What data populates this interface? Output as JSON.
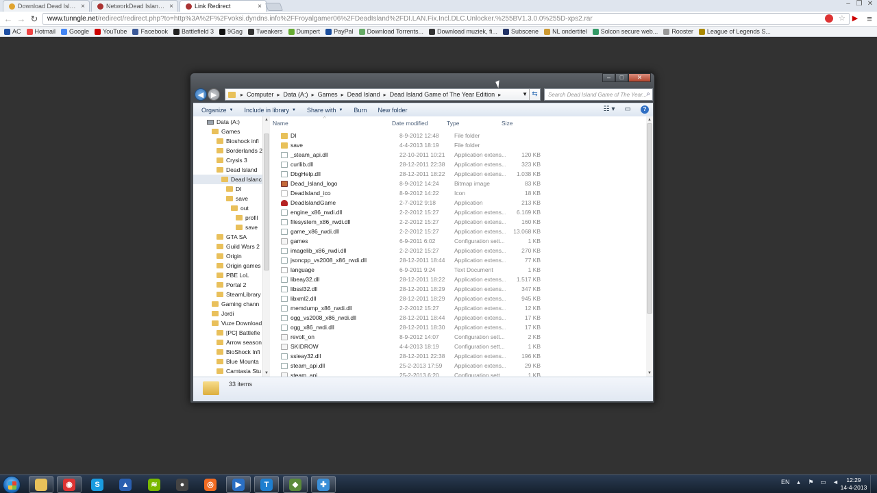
{
  "browser": {
    "tabs": [
      {
        "label": "Download Dead Island Ga",
        "active": false,
        "color": "#e0a32e"
      },
      {
        "label": "NetworkDead Island - Tu",
        "active": false,
        "color": "#a33"
      },
      {
        "label": "Link Redirect",
        "active": true,
        "color": "#a33"
      }
    ],
    "url_domain": "www.tunngle.net",
    "url_rest": "/redirect/redirect.php?to=http%3A%2F%2Fvoksi.dyndns.info%2FFroyalgamer06%2FDeadIsland%2FDI.LAN.Fix.Incl.DLC.Unlocker.%255BV1.3.0.0%255D-xps2.rar",
    "bookmarks": [
      {
        "label": "AC",
        "color": "#1e4fa3"
      },
      {
        "label": "Hotmail",
        "color": "#e44"
      },
      {
        "label": "Google",
        "color": "#4285f4"
      },
      {
        "label": "YouTube",
        "color": "#c00"
      },
      {
        "label": "Facebook",
        "color": "#3b5998"
      },
      {
        "label": "Battlefield 3",
        "color": "#222"
      },
      {
        "label": "9Gag",
        "color": "#111"
      },
      {
        "label": "Tweakers",
        "color": "#333"
      },
      {
        "label": "Dumpert",
        "color": "#6a3"
      },
      {
        "label": "PayPal",
        "color": "#1a4d9c"
      },
      {
        "label": "Download Torrents...",
        "color": "#6a6"
      },
      {
        "label": "Download muziek, fi...",
        "color": "#333"
      },
      {
        "label": "Subscene",
        "color": "#236"
      },
      {
        "label": "NL ondertitel",
        "color": "#c93"
      },
      {
        "label": "Solcon secure web...",
        "color": "#396"
      },
      {
        "label": "Rooster",
        "color": "#999"
      },
      {
        "label": "League of Legends S...",
        "color": "#a80"
      }
    ]
  },
  "explorer": {
    "breadcrumb": [
      "Computer",
      "Data (A:)",
      "Games",
      "Dead Island",
      "Dead Island Game of The Year Edition"
    ],
    "search_placeholder": "Search Dead Island Game of The Year...",
    "toolbar": {
      "organize": "Organize",
      "include": "Include in library",
      "share": "Share with",
      "burn": "Burn",
      "new_folder": "New folder"
    },
    "tree": [
      {
        "label": "Data (A:)",
        "indent": 0,
        "kind": "drive"
      },
      {
        "label": "Games",
        "indent": 1,
        "kind": "folder"
      },
      {
        "label": "Bioshock infi",
        "indent": 2,
        "kind": "folder"
      },
      {
        "label": "Borderlands 2",
        "indent": 2,
        "kind": "folder"
      },
      {
        "label": "Crysis 3",
        "indent": 2,
        "kind": "folder"
      },
      {
        "label": "Dead Island",
        "indent": 2,
        "kind": "folder"
      },
      {
        "label": "Dead Islanc",
        "indent": 3,
        "kind": "folder",
        "selected": true
      },
      {
        "label": "DI",
        "indent": 4,
        "kind": "folder"
      },
      {
        "label": "save",
        "indent": 4,
        "kind": "folder"
      },
      {
        "label": "out",
        "indent": 5,
        "kind": "folder"
      },
      {
        "label": "profil",
        "indent": 6,
        "kind": "folder"
      },
      {
        "label": "save",
        "indent": 6,
        "kind": "folder"
      },
      {
        "label": "GTA SA",
        "indent": 2,
        "kind": "folder"
      },
      {
        "label": "Guild Wars 2",
        "indent": 2,
        "kind": "folder"
      },
      {
        "label": "Origin",
        "indent": 2,
        "kind": "folder"
      },
      {
        "label": "Origin games",
        "indent": 2,
        "kind": "folder"
      },
      {
        "label": "PBE LoL",
        "indent": 2,
        "kind": "folder"
      },
      {
        "label": "Portal 2",
        "indent": 2,
        "kind": "folder"
      },
      {
        "label": "SteamLibrary",
        "indent": 2,
        "kind": "folder"
      },
      {
        "label": "Gaming chann",
        "indent": 1,
        "kind": "folder"
      },
      {
        "label": "Jordi",
        "indent": 1,
        "kind": "folder"
      },
      {
        "label": "Vuze Download",
        "indent": 1,
        "kind": "folder"
      },
      {
        "label": "[PC] Battlefie",
        "indent": 2,
        "kind": "folder"
      },
      {
        "label": "Arrow season",
        "indent": 2,
        "kind": "folder"
      },
      {
        "label": "BioShock Infi",
        "indent": 2,
        "kind": "folder"
      },
      {
        "label": "Blue Mounta",
        "indent": 2,
        "kind": "folder"
      },
      {
        "label": "Camtasia Stu",
        "indent": 2,
        "kind": "folder"
      }
    ],
    "columns": {
      "name": "Name",
      "date": "Date modified",
      "type": "Type",
      "size": "Size"
    },
    "files": [
      {
        "name": "DI",
        "date": "8-9-2012 12:48",
        "type": "File folder",
        "size": "",
        "icon": "folder"
      },
      {
        "name": "save",
        "date": "4-4-2013 18:19",
        "type": "File folder",
        "size": "",
        "icon": "folder"
      },
      {
        "name": "_steam_api.dll",
        "date": "22-10-2011 10:21",
        "type": "Application extens...",
        "size": "120 KB",
        "icon": "dll"
      },
      {
        "name": "curllib.dll",
        "date": "28-12-2011 22:38",
        "type": "Application extens...",
        "size": "323 KB",
        "icon": "dll"
      },
      {
        "name": "DbgHelp.dll",
        "date": "28-12-2011 18:22",
        "type": "Application extens...",
        "size": "1.038 KB",
        "icon": "dll"
      },
      {
        "name": "Dead_Island_logo",
        "date": "8-9-2012 14:24",
        "type": "Bitmap image",
        "size": "83 KB",
        "icon": "bmp"
      },
      {
        "name": "DeadIsland_ico",
        "date": "8-9-2012 14:22",
        "type": "Icon",
        "size": "18 KB",
        "icon": "ico"
      },
      {
        "name": "DeadIslandGame",
        "date": "2-7-2012 9:18",
        "type": "Application",
        "size": "213 KB",
        "icon": "app"
      },
      {
        "name": "engine_x86_rwdi.dll",
        "date": "2-2-2012 15:27",
        "type": "Application extens...",
        "size": "6.169 KB",
        "icon": "dll"
      },
      {
        "name": "filesystem_x86_rwdi.dll",
        "date": "2-2-2012 15:27",
        "type": "Application extens...",
        "size": "160 KB",
        "icon": "dll"
      },
      {
        "name": "game_x86_rwdi.dll",
        "date": "2-2-2012 15:27",
        "type": "Application extens...",
        "size": "13.068 KB",
        "icon": "dll"
      },
      {
        "name": "games",
        "date": "6-9-2011 6:02",
        "type": "Configuration sett...",
        "size": "1 KB",
        "icon": "cfg"
      },
      {
        "name": "imagelib_x86_rwdi.dll",
        "date": "2-2-2012 15:27",
        "type": "Application extens...",
        "size": "270 KB",
        "icon": "dll"
      },
      {
        "name": "jsoncpp_vs2008_x86_rwdi.dll",
        "date": "28-12-2011 18:44",
        "type": "Application extens...",
        "size": "77 KB",
        "icon": "dll"
      },
      {
        "name": "language",
        "date": "6-9-2011 9:24",
        "type": "Text Document",
        "size": "1 KB",
        "icon": "txt"
      },
      {
        "name": "libeay32.dll",
        "date": "28-12-2011 18:22",
        "type": "Application extens...",
        "size": "1.517 KB",
        "icon": "dll"
      },
      {
        "name": "libssl32.dll",
        "date": "28-12-2011 18:29",
        "type": "Application extens...",
        "size": "347 KB",
        "icon": "dll"
      },
      {
        "name": "libxml2.dll",
        "date": "28-12-2011 18:29",
        "type": "Application extens...",
        "size": "945 KB",
        "icon": "dll"
      },
      {
        "name": "memdump_x86_rwdi.dll",
        "date": "2-2-2012 15:27",
        "type": "Application extens...",
        "size": "12 KB",
        "icon": "dll"
      },
      {
        "name": "ogg_vs2008_x86_rwdi.dll",
        "date": "28-12-2011 18:44",
        "type": "Application extens...",
        "size": "17 KB",
        "icon": "dll"
      },
      {
        "name": "ogg_x86_rwdi.dll",
        "date": "28-12-2011 18:30",
        "type": "Application extens...",
        "size": "17 KB",
        "icon": "dll"
      },
      {
        "name": "revolt_on",
        "date": "8-9-2012 14:07",
        "type": "Configuration sett...",
        "size": "2 KB",
        "icon": "cfg"
      },
      {
        "name": "SKIDROW",
        "date": "4-4-2013 18:19",
        "type": "Configuration sett...",
        "size": "1 KB",
        "icon": "cfg"
      },
      {
        "name": "ssleay32.dll",
        "date": "28-12-2011 22:38",
        "type": "Application extens...",
        "size": "196 KB",
        "icon": "dll"
      },
      {
        "name": "steam_api.dll",
        "date": "25-2-2013 17:59",
        "type": "Application extens...",
        "size": "29 KB",
        "icon": "dll"
      },
      {
        "name": "steam_api",
        "date": "25-2-2013 6:20",
        "type": "Configuration sett...",
        "size": "1 KB",
        "icon": "cfg"
      }
    ],
    "status": "33 items"
  },
  "taskbar": {
    "apps": [
      {
        "name": "explorer",
        "color": "#e8c15a",
        "glyph": "",
        "running": true
      },
      {
        "name": "chrome",
        "color": "#d33",
        "glyph": "◉",
        "running": true
      },
      {
        "name": "skype",
        "color": "#1a9ce0",
        "glyph": "S",
        "running": false
      },
      {
        "name": "vuze",
        "color": "#2a5fb0",
        "glyph": "▲",
        "running": false
      },
      {
        "name": "spotify",
        "color": "#7ab800",
        "glyph": "≋",
        "running": false
      },
      {
        "name": "steam",
        "color": "#444",
        "glyph": "●",
        "running": false
      },
      {
        "name": "origin",
        "color": "#f26b21",
        "glyph": "◎",
        "running": false
      },
      {
        "name": "media-player",
        "color": "#2a6fc4",
        "glyph": "▶",
        "running": true
      },
      {
        "name": "tunngle",
        "color": "#1e7fd0",
        "glyph": "T",
        "running": true
      },
      {
        "name": "camtasia",
        "color": "#5a8a3a",
        "glyph": "◆",
        "running": true
      },
      {
        "name": "network",
        "color": "#3a8fd8",
        "glyph": "✚",
        "running": true
      }
    ],
    "lang": "EN",
    "time": "12:29",
    "date": "14-4-2013"
  }
}
